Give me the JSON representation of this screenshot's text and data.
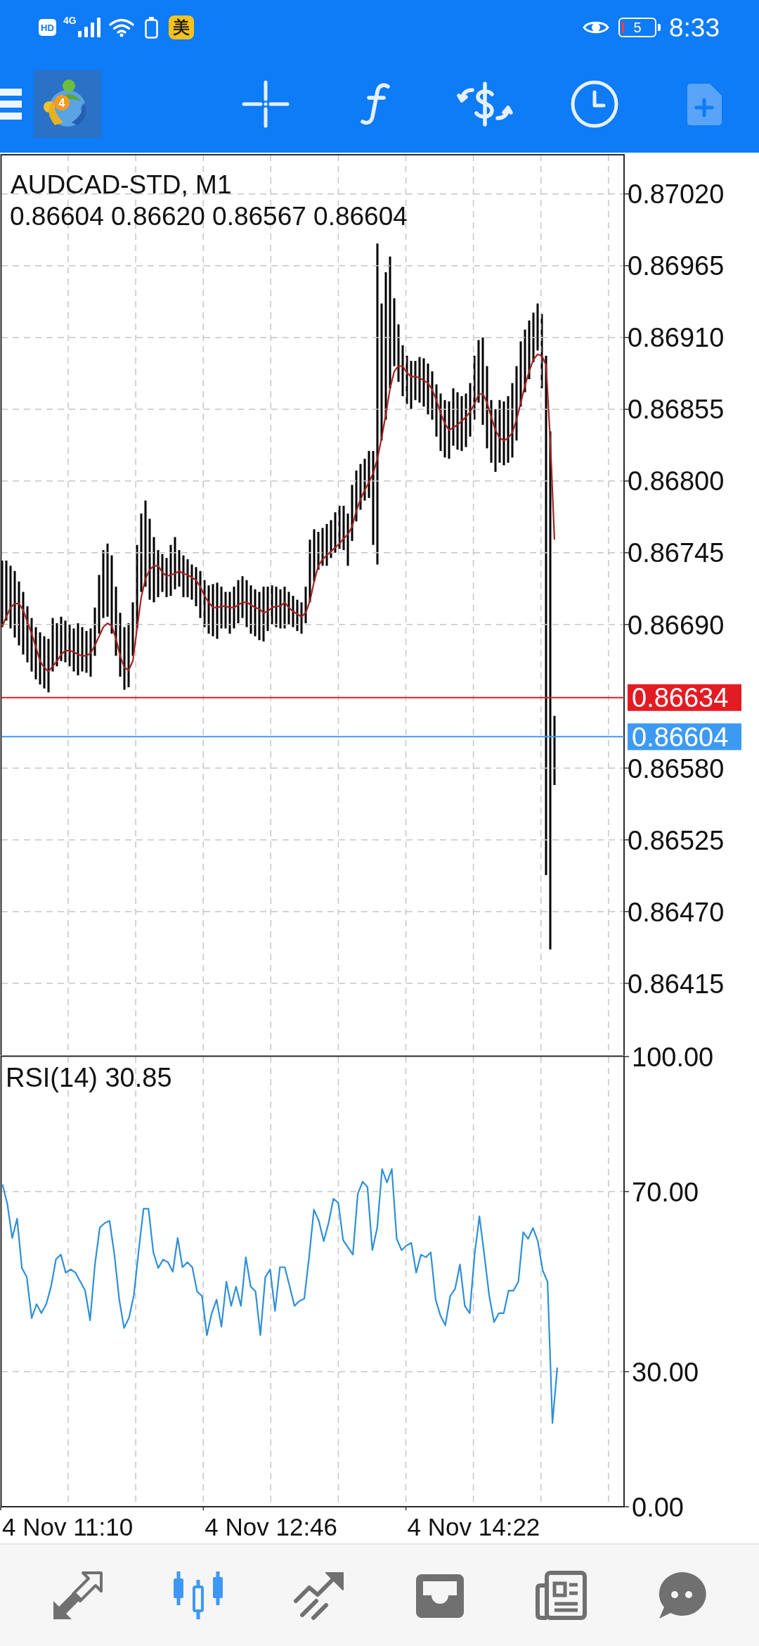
{
  "status_bar": {
    "hd": "HD",
    "network": "4G",
    "app_badge": "美",
    "battery": "5",
    "time": "8:33"
  },
  "toolbar": {
    "logo_badge": "4",
    "buttons": [
      {
        "disabled": false
      },
      {
        "disabled": false
      },
      {
        "disabled": false
      },
      {
        "disabled": false
      },
      {
        "disabled": true
      }
    ]
  },
  "price_chart": {
    "ohlc": "0.86604 0.86620 0.86567 0.86604",
    "chart_data": {
      "type": "line",
      "title": "AUDCAD-STD, M1",
      "grid": true,
      "ylim": [
        0.8636,
        0.8705
      ],
      "yticks": [
        {
          "value": 0.8702,
          "label": "0.87020"
        },
        {
          "value": 0.86965,
          "label": "0.86965"
        },
        {
          "value": 0.8691,
          "label": "0.86910"
        },
        {
          "value": 0.86855,
          "label": "0.86855"
        },
        {
          "value": 0.868,
          "label": "0.86800"
        },
        {
          "value": 0.86745,
          "label": "0.86745"
        },
        {
          "value": 0.8669,
          "label": "0.86690"
        },
        {
          "value": 0.8658,
          "label": "0.86580"
        },
        {
          "value": 0.86525,
          "label": "0.86525"
        },
        {
          "value": 0.8647,
          "label": "0.86470"
        },
        {
          "value": 0.86415,
          "label": "0.86415"
        }
      ],
      "series": [
        {
          "color": "#a32424",
          "values": [
            0.86688,
            0.86696,
            0.86703,
            0.86706,
            0.86706,
            0.86701,
            0.86692,
            0.86683,
            0.86673,
            0.86662,
            0.86657,
            0.86654,
            0.86658,
            0.86662,
            0.86667,
            0.8667,
            0.8667,
            0.86669,
            0.86667,
            0.86666,
            0.86666,
            0.86668,
            0.86674,
            0.86681,
            0.86688,
            0.86691,
            0.86689,
            0.86679,
            0.86666,
            0.86657,
            0.86655,
            0.86662,
            0.86687,
            0.86711,
            0.86725,
            0.86732,
            0.86735,
            0.86735,
            0.8673,
            0.86727,
            0.86728,
            0.86729,
            0.86731,
            0.86729,
            0.86728,
            0.86726,
            0.86724,
            0.86719,
            0.86712,
            0.86707,
            0.86703,
            0.86703,
            0.86704,
            0.86704,
            0.86703,
            0.86703,
            0.86705,
            0.86707,
            0.86707,
            0.86705,
            0.86703,
            0.86702,
            0.86699,
            0.867,
            0.86703,
            0.86704,
            0.86704,
            0.86707,
            0.86703,
            0.867,
            0.86698,
            0.86696,
            0.86699,
            0.86708,
            0.86723,
            0.86735,
            0.8674,
            0.86743,
            0.86746,
            0.86749,
            0.86752,
            0.86756,
            0.86759,
            0.86765,
            0.86777,
            0.86786,
            0.86793,
            0.86799,
            0.86806,
            0.86817,
            0.86833,
            0.86851,
            0.86871,
            0.86884,
            0.86888,
            0.86888,
            0.86883,
            0.8688,
            0.8688,
            0.86879,
            0.86877,
            0.86875,
            0.8687,
            0.86862,
            0.86852,
            0.86844,
            0.86839,
            0.86841,
            0.86843,
            0.86846,
            0.86849,
            0.86853,
            0.86859,
            0.86866,
            0.86867,
            0.8686,
            0.86849,
            0.86839,
            0.86833,
            0.86831,
            0.86833,
            0.86837,
            0.86847,
            0.8686,
            0.86873,
            0.86884,
            0.86893,
            0.86897,
            0.86896,
            0.86889,
            0.86831,
            0.86755
          ]
        }
      ],
      "ref_lines": [
        {
          "axis": "y",
          "value": 0.86634,
          "label": "0.86634",
          "color": "#e31b23"
        },
        {
          "axis": "y",
          "value": 0.86604,
          "label": "0.86604",
          "color": "#3d9af2"
        }
      ]
    }
  },
  "rsi_chart": {
    "chart_data": {
      "type": "line",
      "title": "RSI(14) 30.85",
      "grid": true,
      "ylim": [
        0,
        100
      ],
      "yticks": [
        {
          "value": 100,
          "label": "100.00"
        },
        {
          "value": 70,
          "label": "70.00"
        },
        {
          "value": 30,
          "label": "30.00"
        },
        {
          "value": 0,
          "label": "0.00"
        }
      ],
      "series": [
        {
          "color": "#2f8fd8",
          "values": [
            71.6,
            67.3,
            59.7,
            64,
            53,
            51,
            41.9,
            45,
            43,
            45,
            49,
            55,
            56,
            52,
            52.7,
            52,
            50,
            48,
            41.4,
            53.8,
            62,
            63,
            63.5,
            56,
            46,
            39.7,
            42,
            47,
            57,
            66.2,
            66.2,
            56.5,
            53,
            54.9,
            54.3,
            52.2,
            59.7,
            53.2,
            54.3,
            53.2,
            47.8,
            46.8,
            38.1,
            43,
            46,
            40,
            50,
            44.6,
            48.9,
            44.6,
            55.4,
            48.9,
            47.8,
            38.1,
            51,
            52.7,
            43.5,
            53.2,
            53.2,
            49,
            44.6,
            45.7,
            46.2,
            55.4,
            66,
            63.5,
            59,
            63,
            68.4,
            67.5,
            59.2,
            57.6,
            56,
            69.5,
            72.2,
            71,
            57,
            62,
            75,
            72,
            75,
            59.5,
            57,
            58,
            58.6,
            52,
            56,
            55.4,
            56.5,
            46,
            42.4,
            40.3,
            46.8,
            48.4,
            53.8,
            44.6,
            43,
            56,
            64.5,
            56,
            47,
            41,
            43,
            43,
            48,
            48,
            50,
            61,
            59.5,
            61.9,
            59,
            52.5,
            50,
            18.6,
            30.9
          ]
        }
      ]
    }
  },
  "time_axis": [
    "4 Nov 11:10",
    "4 Nov 12:46",
    "4 Nov 14:22"
  ],
  "bottom_nav": [
    {
      "selected": false
    },
    {
      "selected": true
    },
    {
      "selected": false
    },
    {
      "selected": false
    },
    {
      "selected": false
    },
    {
      "selected": false
    }
  ]
}
